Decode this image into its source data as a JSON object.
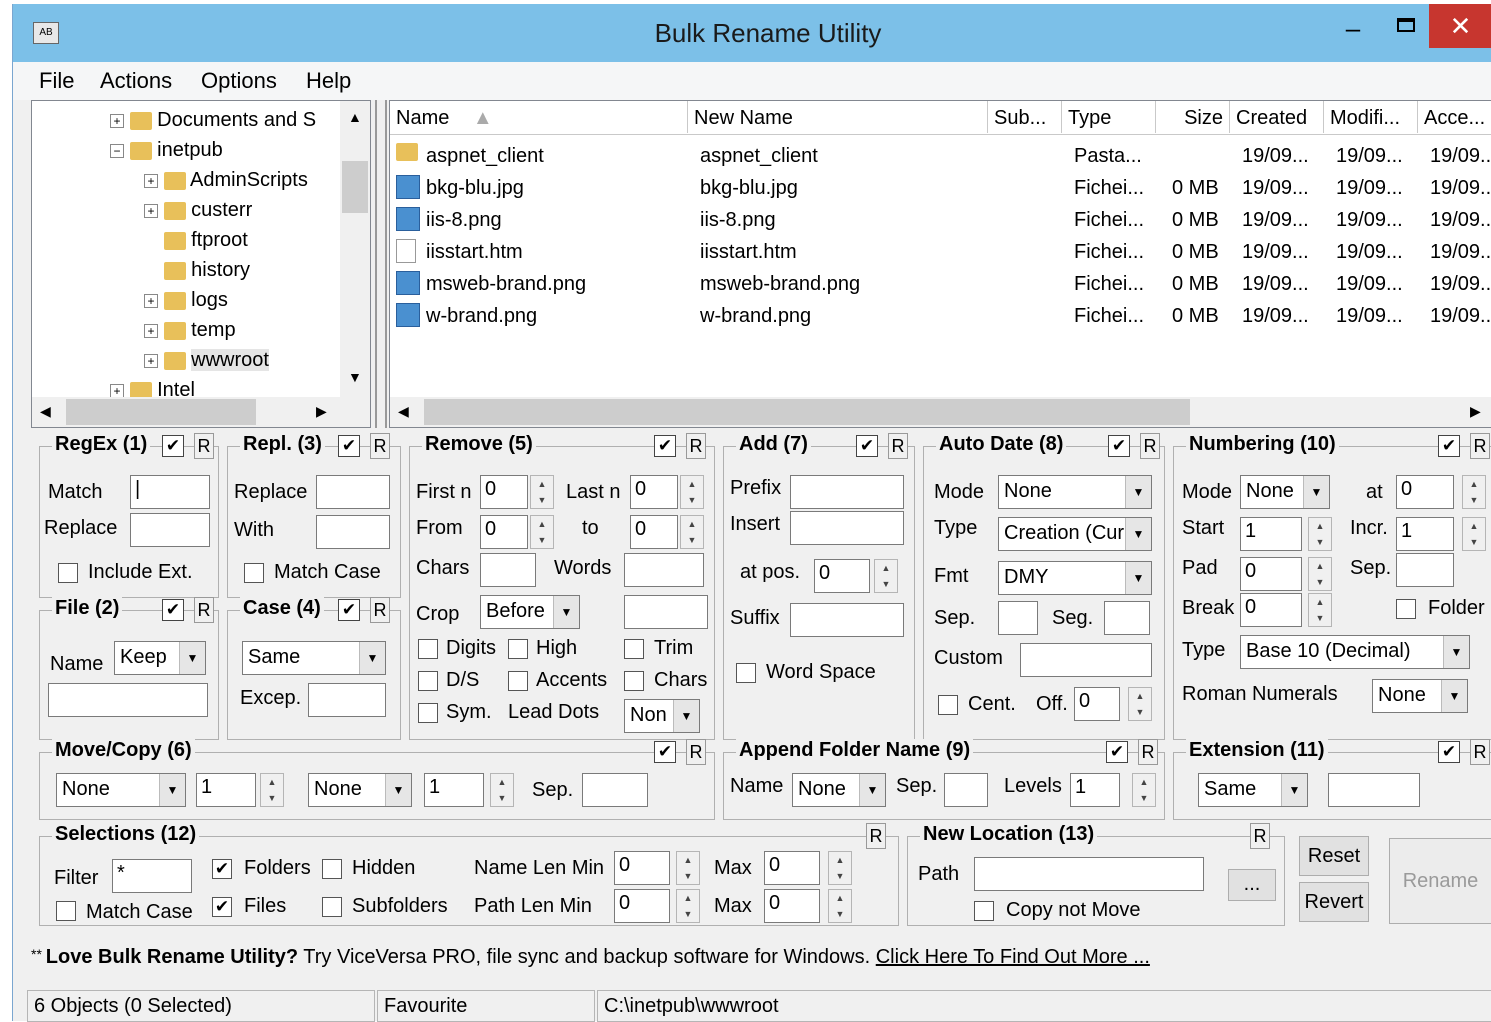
{
  "window": {
    "title": "Bulk Rename Utility"
  },
  "menu": [
    "File",
    "Actions",
    "Options",
    "Help"
  ],
  "tree": [
    {
      "label": "Documents and S",
      "depth": 1,
      "exp": "+",
      "special": true
    },
    {
      "label": "inetpub",
      "depth": 1,
      "exp": "−"
    },
    {
      "label": "AdminScripts",
      "depth": 2,
      "exp": "+"
    },
    {
      "label": "custerr",
      "depth": 2,
      "exp": "+"
    },
    {
      "label": "ftproot",
      "depth": 2,
      "exp": ""
    },
    {
      "label": "history",
      "depth": 2,
      "exp": ""
    },
    {
      "label": "logs",
      "depth": 2,
      "exp": "+"
    },
    {
      "label": "temp",
      "depth": 2,
      "exp": "+"
    },
    {
      "label": "wwwroot",
      "depth": 2,
      "exp": "+",
      "selected": true
    },
    {
      "label": "Intel",
      "depth": 1,
      "exp": "+"
    }
  ],
  "filelist": {
    "columns": [
      "Name",
      "New Name",
      "Sub...",
      "Type",
      "Size",
      "Created",
      "Modifi...",
      "Acce..."
    ],
    "rows": [
      {
        "icon": "folder",
        "name": "aspnet_client",
        "new": "aspnet_client",
        "type": "Pasta...",
        "size": "",
        "created": "19/09...",
        "modified": "19/09...",
        "accessed": "19/09..."
      },
      {
        "icon": "image",
        "name": "bkg-blu.jpg",
        "new": "bkg-blu.jpg",
        "type": "Fichei...",
        "size": "0 MB",
        "created": "19/09...",
        "modified": "19/09...",
        "accessed": "19/09..."
      },
      {
        "icon": "image",
        "name": "iis-8.png",
        "new": "iis-8.png",
        "type": "Fichei...",
        "size": "0 MB",
        "created": "19/09...",
        "modified": "19/09...",
        "accessed": "19/09..."
      },
      {
        "icon": "doc",
        "name": "iisstart.htm",
        "new": "iisstart.htm",
        "type": "Fichei...",
        "size": "0 MB",
        "created": "19/09...",
        "modified": "19/09...",
        "accessed": "19/09..."
      },
      {
        "icon": "image",
        "name": "msweb-brand.png",
        "new": "msweb-brand.png",
        "type": "Fichei...",
        "size": "0 MB",
        "created": "19/09...",
        "modified": "19/09...",
        "accessed": "19/09..."
      },
      {
        "icon": "image",
        "name": "w-brand.png",
        "new": "w-brand.png",
        "type": "Fichei...",
        "size": "0 MB",
        "created": "19/09...",
        "modified": "19/09...",
        "accessed": "19/09..."
      }
    ]
  },
  "regex": {
    "title": "RegEx (1)",
    "match": "Match",
    "replace": "Replace",
    "include_ext": "Include Ext."
  },
  "repl": {
    "title": "Repl. (3)",
    "replace": "Replace",
    "with": "With",
    "match_case": "Match Case"
  },
  "remove": {
    "title": "Remove (5)",
    "first_n": "First n",
    "first_n_val": "0",
    "last_n": "Last n",
    "last_n_val": "0",
    "from": "From",
    "from_val": "0",
    "to": "to",
    "to_val": "0",
    "chars": "Chars",
    "words": "Words",
    "crop": "Crop",
    "crop_val": "Before",
    "digits": "Digits",
    "high": "High",
    "trim": "Trim",
    "ds": "D/S",
    "accents": "Accents",
    "chars2": "Chars",
    "sym": "Sym.",
    "lead_dots": "Lead Dots",
    "lead_dots_val": "Non"
  },
  "add": {
    "title": "Add (7)",
    "prefix": "Prefix",
    "insert": "Insert",
    "at_pos": "at pos.",
    "at_pos_val": "0",
    "suffix": "Suffix",
    "word_space": "Word Space"
  },
  "autodate": {
    "title": "Auto Date (8)",
    "mode": "Mode",
    "mode_val": "None",
    "type": "Type",
    "type_val": "Creation (Cur",
    "fmt": "Fmt",
    "fmt_val": "DMY",
    "sep": "Sep.",
    "seg": "Seg.",
    "custom": "Custom",
    "cent": "Cent.",
    "off": "Off.",
    "off_val": "0"
  },
  "numbering": {
    "title": "Numbering (10)",
    "mode": "Mode",
    "mode_val": "None",
    "at": "at",
    "at_val": "0",
    "start": "Start",
    "start_val": "1",
    "incr": "Incr.",
    "incr_val": "1",
    "pad": "Pad",
    "pad_val": "0",
    "sep": "Sep.",
    "brk": "Break",
    "brk_val": "0",
    "folder": "Folder",
    "type": "Type",
    "type_val": "Base 10 (Decimal)",
    "roman": "Roman Numerals",
    "roman_val": "None"
  },
  "file": {
    "title": "File (2)",
    "name": "Name",
    "name_val": "Keep"
  },
  "case": {
    "title": "Case (4)",
    "case_val": "Same",
    "excep": "Excep."
  },
  "movecopy": {
    "title": "Move/Copy (6)",
    "sel1": "None",
    "num1": "1",
    "sel2": "None",
    "num2": "1",
    "sep": "Sep."
  },
  "appendfolder": {
    "title": "Append Folder Name (9)",
    "name": "Name",
    "name_val": "None",
    "sep": "Sep.",
    "levels": "Levels",
    "levels_val": "1"
  },
  "extension": {
    "title": "Extension (11)",
    "val": "Same"
  },
  "selections": {
    "title": "Selections (12)",
    "filter": "Filter",
    "filter_val": "*",
    "folders": "Folders",
    "hidden": "Hidden",
    "files": "Files",
    "subfolders": "Subfolders",
    "match_case": "Match Case",
    "name_len_min": "Name Len Min",
    "name_len_min_val": "0",
    "path_len_min": "Path Len Min",
    "path_len_min_val": "0",
    "max": "Max",
    "max1_val": "0",
    "max2_val": "0"
  },
  "newloc": {
    "title": "New Location (13)",
    "path": "Path",
    "browse": "...",
    "copy_not_move": "Copy not Move"
  },
  "actions": {
    "reset": "Reset",
    "revert": "Revert",
    "rename": "Rename"
  },
  "r_label": "R",
  "promo": {
    "prefix": "** ",
    "bold": "Love Bulk Rename Utility?",
    "text": " Try ViceVersa PRO, file sync and backup software for Windows. ",
    "link": "Click Here To Find Out More ..."
  },
  "status": {
    "objects": "6 Objects (0 Selected)",
    "favourite": "Favourite",
    "path": "C:\\inetpub\\wwwroot"
  }
}
